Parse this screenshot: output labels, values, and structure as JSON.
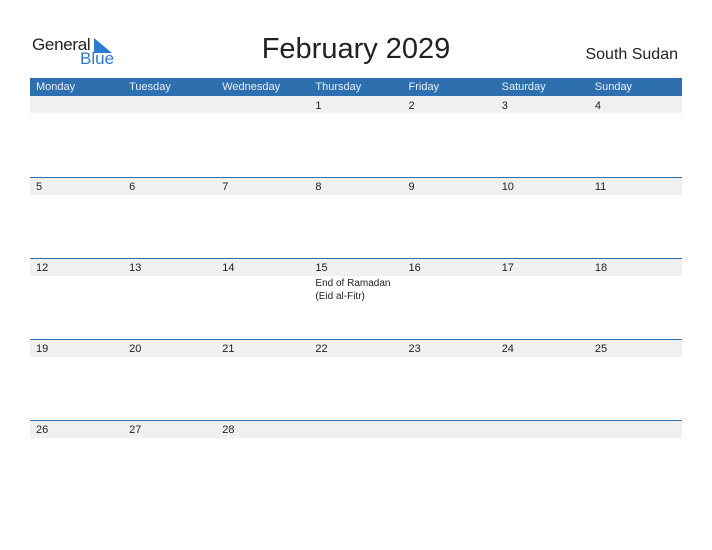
{
  "logo": {
    "general": "General",
    "blue": "Blue"
  },
  "title": "February 2029",
  "country": "South Sudan",
  "colors": {
    "accent": "#2e6fb0",
    "date_bar": "#f0f0f0",
    "logo_blue": "#2b7bd1"
  },
  "weekdays": [
    "Monday",
    "Tuesday",
    "Wednesday",
    "Thursday",
    "Friday",
    "Saturday",
    "Sunday"
  ],
  "weeks": [
    {
      "days": [
        "",
        "",
        "",
        "1",
        "2",
        "3",
        "4"
      ],
      "events": [
        "",
        "",
        "",
        "",
        "",
        "",
        ""
      ]
    },
    {
      "days": [
        "5",
        "6",
        "7",
        "8",
        "9",
        "10",
        "11"
      ],
      "events": [
        "",
        "",
        "",
        "",
        "",
        "",
        ""
      ]
    },
    {
      "days": [
        "12",
        "13",
        "14",
        "15",
        "16",
        "17",
        "18"
      ],
      "events": [
        "",
        "",
        "",
        "End of Ramadan (Eid al-Fitr)",
        "",
        "",
        ""
      ]
    },
    {
      "days": [
        "19",
        "20",
        "21",
        "22",
        "23",
        "24",
        "25"
      ],
      "events": [
        "",
        "",
        "",
        "",
        "",
        "",
        ""
      ]
    },
    {
      "days": [
        "26",
        "27",
        "28",
        "",
        "",
        "",
        ""
      ],
      "events": [
        "",
        "",
        "",
        "",
        "",
        "",
        ""
      ]
    }
  ]
}
